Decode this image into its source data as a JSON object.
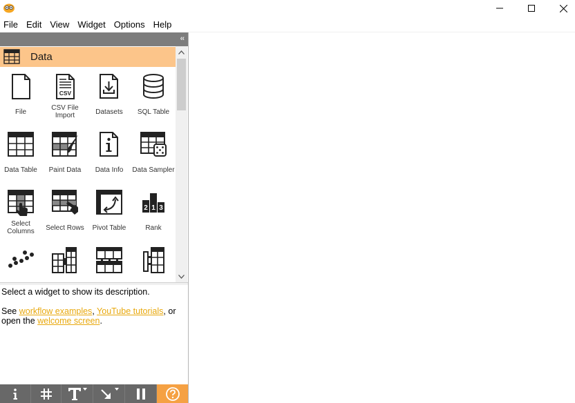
{
  "menu": {
    "items": [
      {
        "label": "File"
      },
      {
        "label": "Edit"
      },
      {
        "label": "View"
      },
      {
        "label": "Widget"
      },
      {
        "label": "Options"
      },
      {
        "label": "Help"
      }
    ]
  },
  "toolbox": {
    "category": {
      "label": "Data",
      "color": "#fcc58a",
      "icon": "table-icon"
    },
    "widgets": [
      {
        "label": "File",
        "icon": "file-icon"
      },
      {
        "label": "CSV File Import",
        "icon": "csv-file-icon"
      },
      {
        "label": "Datasets",
        "icon": "datasets-icon"
      },
      {
        "label": "SQL Table",
        "icon": "database-icon"
      },
      {
        "label": "Data Table",
        "icon": "data-table-icon"
      },
      {
        "label": "Paint Data",
        "icon": "paint-data-icon"
      },
      {
        "label": "Data Info",
        "icon": "data-info-icon"
      },
      {
        "label": "Data Sampler",
        "icon": "data-sampler-icon"
      },
      {
        "label": "Select Columns",
        "icon": "select-columns-icon"
      },
      {
        "label": "Select Rows",
        "icon": "select-rows-icon"
      },
      {
        "label": "Pivot Table",
        "icon": "pivot-table-icon"
      },
      {
        "label": "Rank",
        "icon": "rank-icon"
      },
      {
        "label": "",
        "icon": "scatter-dots-icon"
      },
      {
        "label": "",
        "icon": "merge-columns-icon"
      },
      {
        "label": "",
        "icon": "concatenate-icon"
      },
      {
        "label": "",
        "icon": "split-table-icon"
      }
    ]
  },
  "description": {
    "line1": "Select a widget to show its description.",
    "see_prefix": "See ",
    "link_examples": "workflow examples",
    "comma1": ", ",
    "link_tutorials": "YouTube tutorials",
    "or_text": ", or",
    "open_prefix": "open the ",
    "link_welcome": "welcome screen",
    "period": "."
  },
  "bottom_toolbar": {
    "buttons": [
      {
        "icon": "info-icon",
        "symbol": "i"
      },
      {
        "icon": "grid-icon",
        "symbol": "#"
      },
      {
        "icon": "text-icon",
        "symbol": "T"
      },
      {
        "icon": "arrow-icon",
        "symbol": "↘"
      },
      {
        "icon": "pause-icon",
        "symbol": "II"
      },
      {
        "icon": "help-icon",
        "symbol": "?"
      }
    ],
    "accent": "#f5a143"
  },
  "colors": {
    "link": "#e8a80c",
    "dock_header": "#7d7d7d",
    "toolbar_bg": "#686868"
  }
}
